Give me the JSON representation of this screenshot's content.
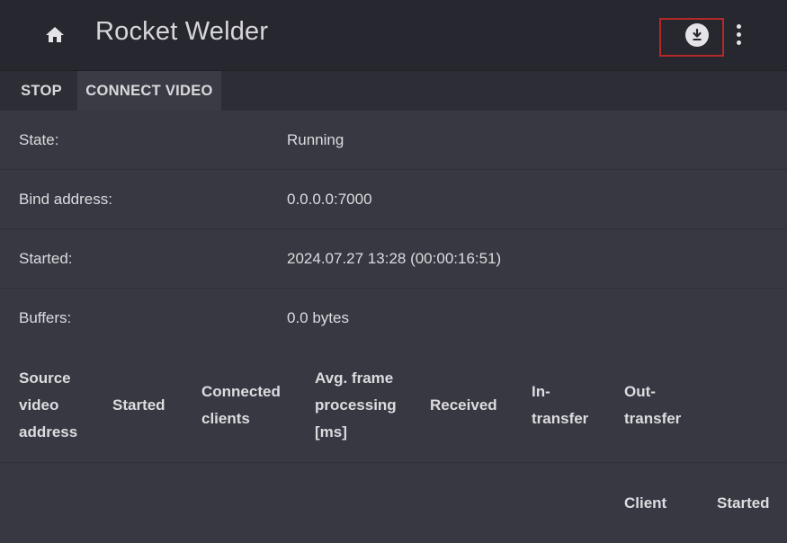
{
  "appbar": {
    "title": "Rocket Welder",
    "icons": {
      "home": "home-icon",
      "download": "download-icon",
      "menu": "more-vert-icon"
    }
  },
  "toolbar": {
    "stop_label": "STOP",
    "connect_video_label": "CONNECT VIDEO"
  },
  "info": {
    "state": {
      "label": "State:",
      "value": "Running"
    },
    "bind_address": {
      "label": "Bind address:",
      "value": "0.0.0.0:7000"
    },
    "started": {
      "label": "Started:",
      "value": "2024.07.27 13:28 (00:00:16:51)"
    },
    "buffers": {
      "label": "Buffers:",
      "value": "0.0 bytes"
    }
  },
  "table": {
    "columns": [
      [
        "Source",
        "video",
        "address"
      ],
      [
        "Started"
      ],
      [
        "Connected",
        "clients"
      ],
      [
        "Avg. frame",
        "processing",
        "[ms]"
      ],
      [
        "Received"
      ],
      [
        "In-",
        "transfer"
      ],
      [
        "Out-",
        "transfer"
      ]
    ],
    "sub_columns": [
      "Client",
      "Started"
    ]
  },
  "colors": {
    "background": "#32333d",
    "appbar": "#27272f",
    "highlight_border": "#b4282a"
  }
}
